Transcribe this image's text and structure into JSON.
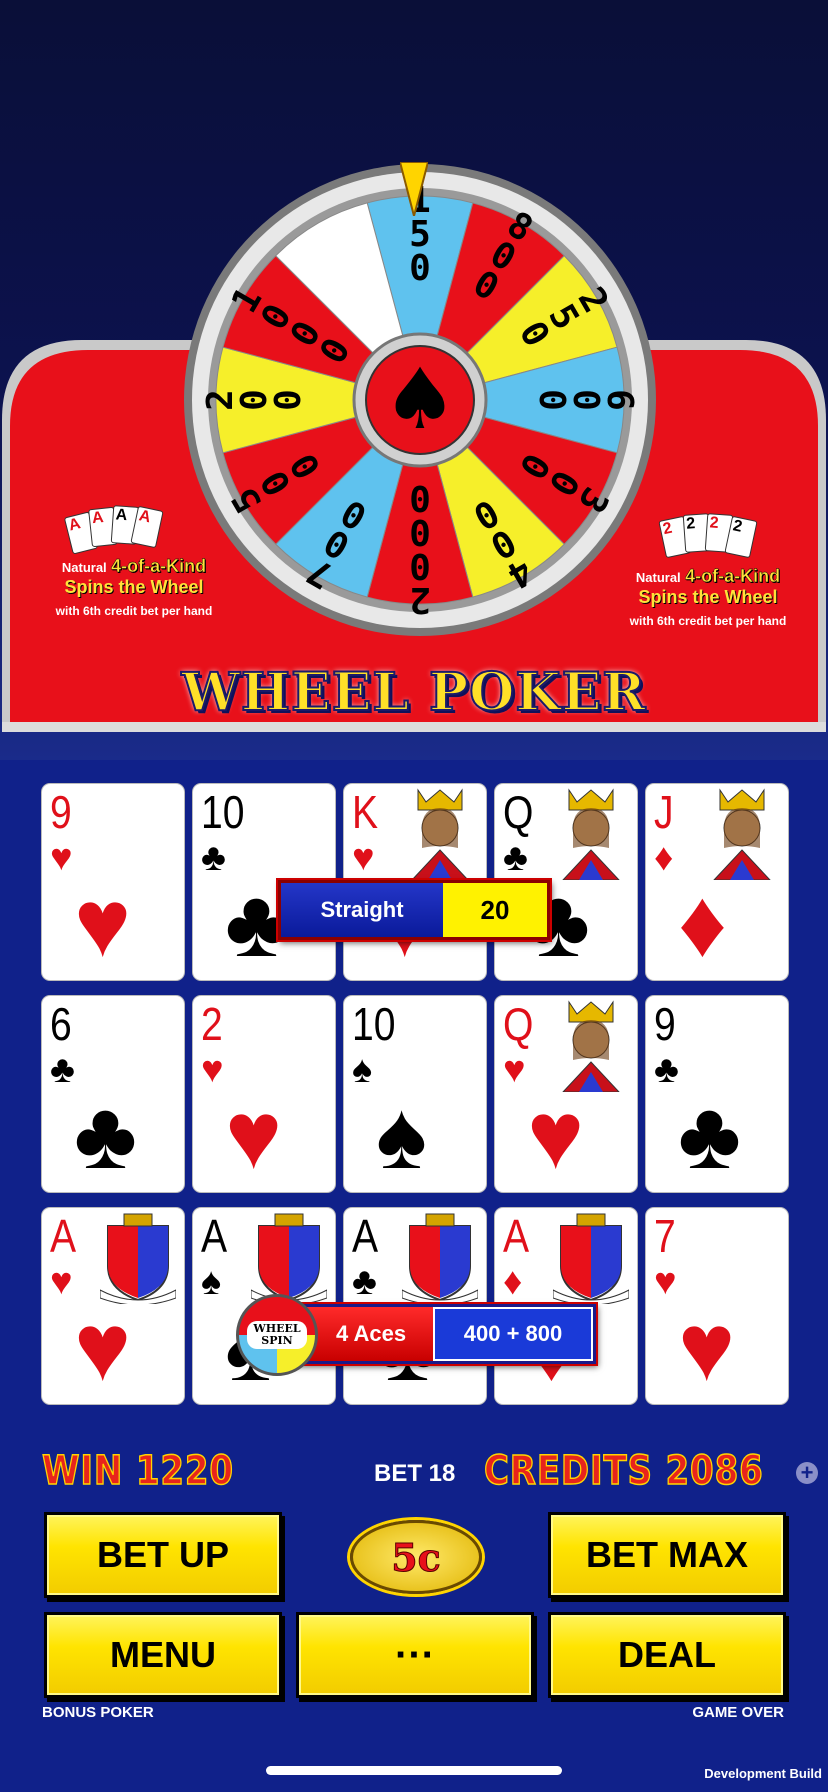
{
  "colors": {
    "table_bg": "#10218a",
    "panel_red": "#e8101a",
    "gold": "#ffe400",
    "card_red": "#e0101a"
  },
  "wheel": {
    "segments": [
      {
        "label": "150",
        "color": "#5fc2ee"
      },
      {
        "label": "800",
        "color": "#e8101a"
      },
      {
        "label": "250",
        "color": "#f6ef2a"
      },
      {
        "label": "600",
        "color": "#5fc2ee"
      },
      {
        "label": "300",
        "color": "#e8101a"
      },
      {
        "label": "400",
        "color": "#f6ef2a"
      },
      {
        "label": "2000",
        "color": "#e8101a"
      },
      {
        "label": "700",
        "color": "#5fc2ee"
      },
      {
        "label": "500",
        "color": "#e8101a"
      },
      {
        "label": "200",
        "color": "#f6ef2a"
      },
      {
        "label": "1000",
        "color": "#e8101a"
      },
      {
        "label": "",
        "color": "#ffffff"
      }
    ],
    "center_icon": "spade-icon"
  },
  "left_promo": {
    "natural": "Natural",
    "kind": "4-of-a-Kind",
    "spins": "Spins the Wheel",
    "note": "with 6th credit bet per hand",
    "cards": [
      "A",
      "A",
      "A",
      "A"
    ]
  },
  "right_promo": {
    "natural": "Natural",
    "kind": "4-of-a-Kind",
    "spins": "Spins the Wheel",
    "note": "with 6th credit bet per hand",
    "cards": [
      "2",
      "2",
      "2",
      "2"
    ]
  },
  "title": "WHEEL POKER",
  "hands": [
    {
      "cards": [
        {
          "rank": "9",
          "suit": "♥",
          "color": "red",
          "face": false
        },
        {
          "rank": "10",
          "suit": "♣",
          "color": "blk",
          "face": false
        },
        {
          "rank": "K",
          "suit": "♥",
          "color": "red",
          "face": true
        },
        {
          "rank": "Q",
          "suit": "♣",
          "color": "blk",
          "face": true
        },
        {
          "rank": "J",
          "suit": "♦",
          "color": "red",
          "face": true
        }
      ],
      "result": {
        "name": "Straight",
        "amount": "20"
      }
    },
    {
      "cards": [
        {
          "rank": "6",
          "suit": "♣",
          "color": "blk",
          "face": false
        },
        {
          "rank": "2",
          "suit": "♥",
          "color": "red",
          "face": false
        },
        {
          "rank": "10",
          "suit": "♠",
          "color": "blk",
          "face": false
        },
        {
          "rank": "Q",
          "suit": "♥",
          "color": "red",
          "face": true
        },
        {
          "rank": "9",
          "suit": "♣",
          "color": "blk",
          "face": false
        }
      ]
    },
    {
      "cards": [
        {
          "rank": "A",
          "suit": "♥",
          "color": "red",
          "face": true
        },
        {
          "rank": "A",
          "suit": "♠",
          "color": "blk",
          "face": true
        },
        {
          "rank": "A",
          "suit": "♣",
          "color": "blk",
          "face": true
        },
        {
          "rank": "A",
          "suit": "♦",
          "color": "red",
          "face": true
        },
        {
          "rank": "7",
          "suit": "♥",
          "color": "red",
          "face": false
        }
      ],
      "result": {
        "name": "4 Aces",
        "amount": "400 + 800",
        "badge": "WHEEL SPIN"
      }
    }
  ],
  "status": {
    "win": "WIN 1220",
    "bet": "BET 18",
    "credits": "CREDITS 2086",
    "plus": "+"
  },
  "buttons": {
    "bet_up": "BET UP",
    "coin": "5c",
    "bet_max": "BET MAX",
    "menu": "MENU",
    "more": "···",
    "deal": "DEAL"
  },
  "footer": {
    "game": "BONUS POKER",
    "state": "GAME OVER",
    "build": "Development Build"
  }
}
